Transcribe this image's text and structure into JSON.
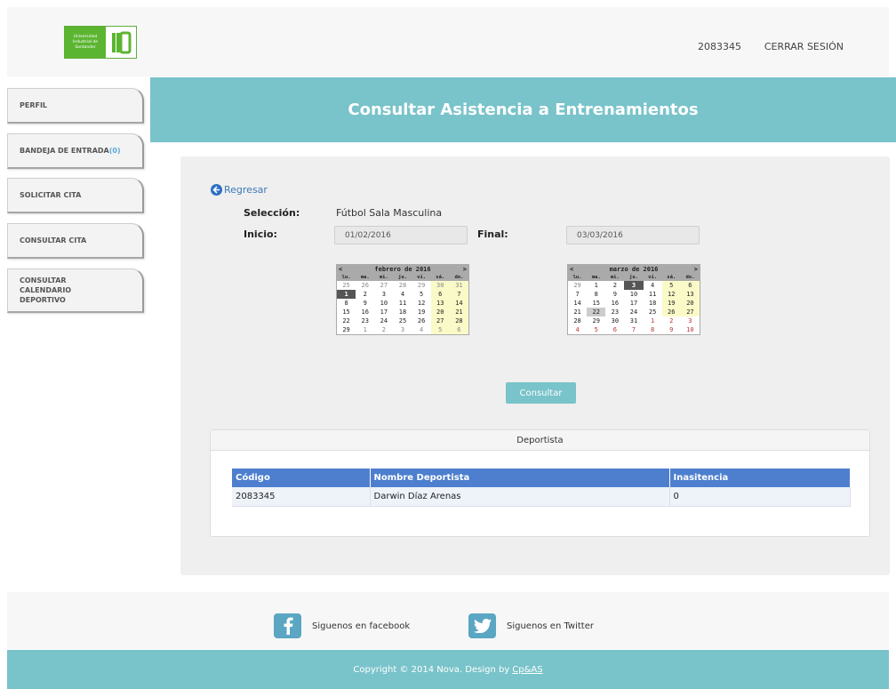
{
  "header": {
    "logo_text": "Universidad Industrial de Santander",
    "user_id": "2083345",
    "logout_label": "CERRAR SESIÓN"
  },
  "sidebar": {
    "items": [
      {
        "label": "PERFIL"
      },
      {
        "label": "BANDEJA DE ENTRADA",
        "count": "(0)"
      },
      {
        "label": "SOLICITAR CITA"
      },
      {
        "label": "CONSULTAR CITA"
      },
      {
        "label": "CONSULTAR CALENDARIO DEPORTIVO"
      }
    ]
  },
  "page": {
    "title": "Consultar Asistencia a Entrenamientos",
    "back_label": "Regresar",
    "selection_label": "Selección:",
    "selection_value": "Fútbol Sala Masculina",
    "start_label": "Inicio:",
    "start_value": "01/02/2016",
    "end_label": "Final:",
    "end_value": "03/03/2016",
    "submit_label": "Consultar"
  },
  "calendar_feb": {
    "prev": "<",
    "next": ">",
    "title": "febrero de 2016",
    "weekdays": [
      "lu.",
      "ma.",
      "mi.",
      "ju.",
      "vi.",
      "sá.",
      "do."
    ],
    "days": [
      "25",
      "26",
      "27",
      "28",
      "29",
      "30",
      "31",
      "1",
      "2",
      "3",
      "4",
      "5",
      "6",
      "7",
      "8",
      "9",
      "10",
      "11",
      "12",
      "13",
      "14",
      "15",
      "16",
      "17",
      "18",
      "19",
      "20",
      "21",
      "22",
      "23",
      "24",
      "25",
      "26",
      "27",
      "28",
      "29",
      "1",
      "2",
      "3",
      "4",
      "5",
      "6"
    ]
  },
  "calendar_mar": {
    "prev": "<",
    "next": ">",
    "title": "marzo de 2016",
    "weekdays": [
      "lu.",
      "ma.",
      "mi.",
      "ju.",
      "vi.",
      "sá.",
      "do."
    ],
    "days": [
      "29",
      "1",
      "2",
      "3",
      "4",
      "5",
      "6",
      "7",
      "8",
      "9",
      "10",
      "11",
      "12",
      "13",
      "14",
      "15",
      "16",
      "17",
      "18",
      "19",
      "20",
      "21",
      "22",
      "23",
      "24",
      "25",
      "26",
      "27",
      "28",
      "29",
      "30",
      "31",
      "1",
      "2",
      "3",
      "4",
      "5",
      "6",
      "7",
      "8",
      "9",
      "10"
    ]
  },
  "result": {
    "title": "Deportista",
    "columns": [
      "Código",
      "Nombre Deportista",
      "Inasitencia"
    ],
    "rows": [
      [
        "2083345",
        "Darwin Díaz Arenas",
        "0"
      ]
    ]
  },
  "social": {
    "facebook_label": "Siguenos en facebook",
    "twitter_label": "Siguenos en Twitter",
    "facebook_icon": "facebook-icon",
    "twitter_icon": "twitter-icon"
  },
  "footer": {
    "copyright": "Copyright © 2014 Nova. Design by",
    "designer": "Cp&AS"
  },
  "colors": {
    "accent": "#79c3ca",
    "table_header": "#4d7fce",
    "brand_green": "#5cb531"
  }
}
